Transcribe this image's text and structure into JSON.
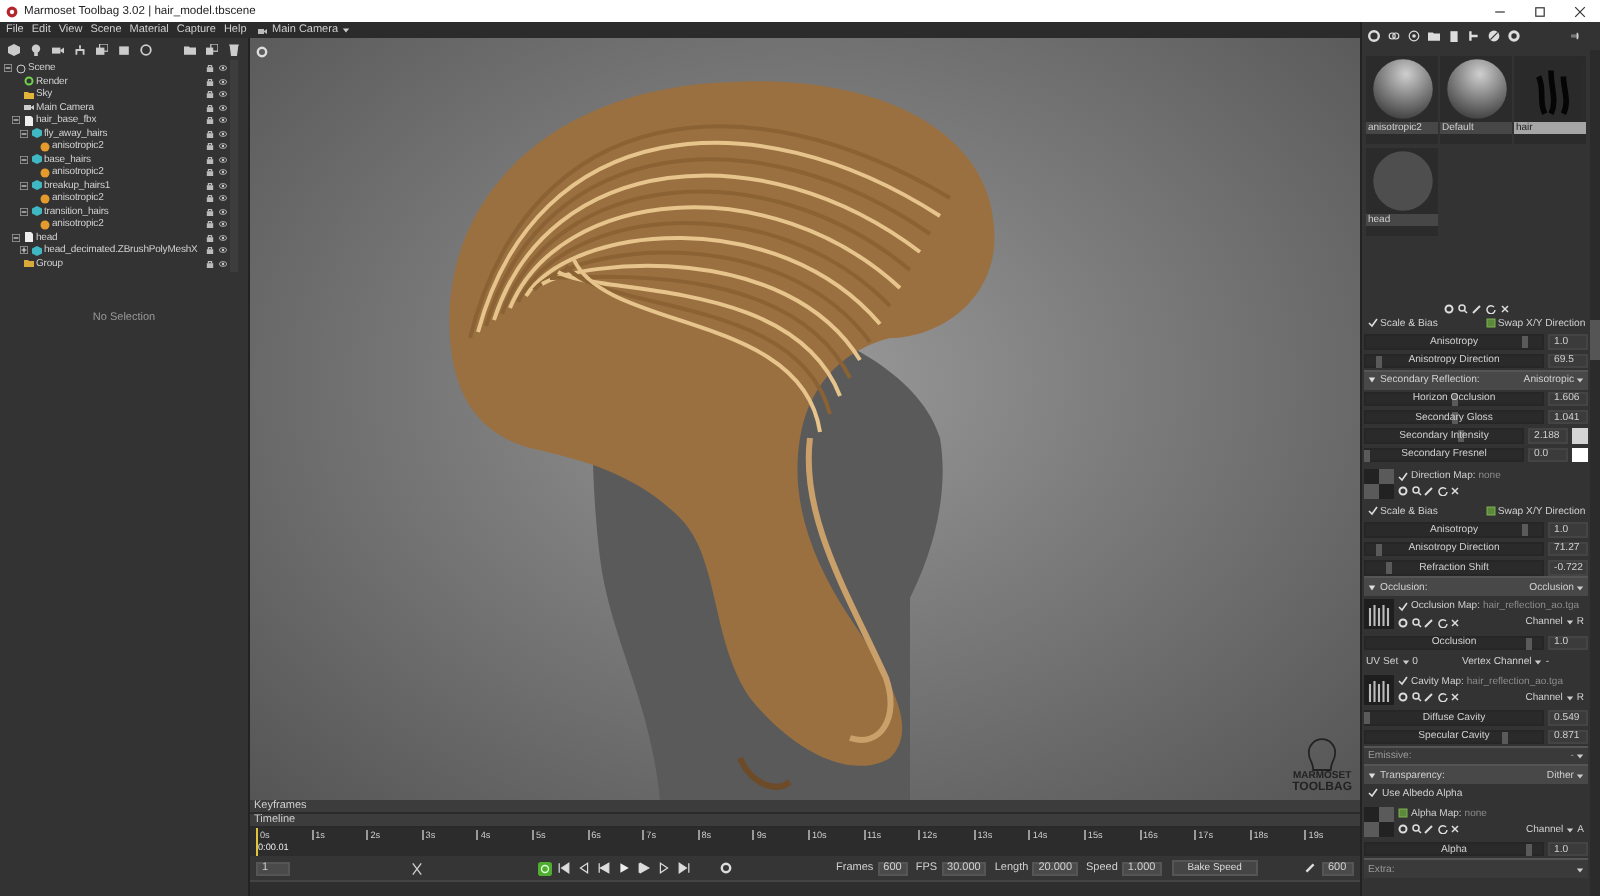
{
  "window": {
    "title": "Marmoset Toolbag 3.02 | hair_model.tbscene"
  },
  "menu": [
    "File",
    "Edit",
    "View",
    "Scene",
    "Material",
    "Capture",
    "Help"
  ],
  "camera_menu": {
    "label": "Main Camera"
  },
  "scene_tree": {
    "items": [
      {
        "label": "Scene",
        "kind": "scene",
        "expanded": true,
        "children": [
          {
            "label": "Render",
            "kind": "render"
          },
          {
            "label": "Sky",
            "kind": "sky"
          },
          {
            "label": "Main Camera",
            "kind": "camera"
          },
          {
            "label": "hair_base_fbx",
            "kind": "file",
            "expanded": true,
            "children": [
              {
                "label": "fly_away_hairs",
                "kind": "mesh",
                "expanded": true,
                "children": [
                  {
                    "label": "anisotropic2",
                    "kind": "material"
                  }
                ]
              },
              {
                "label": "base_hairs",
                "kind": "mesh",
                "expanded": true,
                "children": [
                  {
                    "label": "anisotropic2",
                    "kind": "material"
                  }
                ]
              },
              {
                "label": "breakup_hairs1",
                "kind": "mesh",
                "expanded": true,
                "children": [
                  {
                    "label": "anisotropic2",
                    "kind": "material"
                  }
                ]
              },
              {
                "label": "transition_hairs",
                "kind": "mesh",
                "expanded": true,
                "children": [
                  {
                    "label": "anisotropic2",
                    "kind": "material"
                  }
                ]
              }
            ]
          },
          {
            "label": "head",
            "kind": "file",
            "expanded": true,
            "children": [
              {
                "label": "head_decimated.ZBrushPolyMeshX",
                "kind": "mesh",
                "expanded": false
              }
            ]
          },
          {
            "label": "Group",
            "kind": "folder"
          }
        ]
      }
    ],
    "status": "No Selection"
  },
  "viewport": {
    "logo": [
      "MARMOSET",
      "TOOLBAG"
    ]
  },
  "materials": [
    {
      "name": "anisotropic2",
      "kind": "glossy",
      "selected": false
    },
    {
      "name": "Default",
      "kind": "glossy",
      "selected": false
    },
    {
      "name": "hair",
      "kind": "texture",
      "selected": true
    },
    {
      "name": "head",
      "kind": "matte",
      "selected": false
    }
  ],
  "properties": [
    {
      "kind": "map_tools"
    },
    {
      "kind": "toggles",
      "items": [
        {
          "label": "Scale & Bias",
          "checked": true
        },
        {
          "label": "Swap X/Y Direction",
          "checked": false
        }
      ]
    },
    {
      "kind": "slider",
      "label": "Anisotropy",
      "value": "1.0",
      "level": 0.9
    },
    {
      "kind": "slider",
      "label": "Anisotropy Direction",
      "value": "69.5",
      "level": 0.07
    },
    {
      "kind": "section",
      "title": "Secondary Reflection:",
      "mode": "Anisotropic",
      "expanded": true
    },
    {
      "kind": "slider",
      "label": "Horizon Occlusion",
      "value": "1.606",
      "level": 0.5
    },
    {
      "kind": "slider",
      "label": "Secondary Gloss",
      "value": "1.041",
      "level": 0.5
    },
    {
      "kind": "slider",
      "label": "Secondary Intensity",
      "value": "2.188",
      "level": 0.6,
      "color": "#d4d4d4"
    },
    {
      "kind": "slider",
      "label": "Secondary Fresnel",
      "value": "0.0",
      "level": 0.0,
      "color": "#ffffff"
    },
    {
      "kind": "map",
      "label": "Direction Map:",
      "file": "none",
      "checked": true,
      "has_texture": false
    },
    {
      "kind": "toggles",
      "items": [
        {
          "label": "Scale & Bias",
          "checked": true
        },
        {
          "label": "Swap X/Y Direction",
          "checked": false
        }
      ]
    },
    {
      "kind": "slider",
      "label": "Anisotropy",
      "value": "1.0",
      "level": 0.9
    },
    {
      "kind": "slider",
      "label": "Anisotropy Direction",
      "value": "71.27",
      "level": 0.07
    },
    {
      "kind": "slider",
      "label": "Refraction Shift",
      "value": "-0.722",
      "level": 0.12
    },
    {
      "kind": "section",
      "title": "Occlusion:",
      "mode": "Occlusion",
      "expanded": true
    },
    {
      "kind": "map",
      "label": "Occlusion Map:",
      "file": "hair_reflection_ao.tga",
      "checked": true,
      "has_texture": true,
      "channel_label": "Channel",
      "channel": "R"
    },
    {
      "kind": "slider",
      "label": "Occlusion",
      "value": "1.0",
      "level": 0.92
    },
    {
      "kind": "dropdowns",
      "items": [
        {
          "label": "UV Set",
          "value": "0"
        },
        {
          "label": "Vertex Channel",
          "value": "-"
        }
      ]
    },
    {
      "kind": "map",
      "label": "Cavity Map:",
      "file": "hair_reflection_ao.tga",
      "checked": true,
      "has_texture": true,
      "channel_label": "Channel",
      "channel": "R"
    },
    {
      "kind": "slider",
      "label": "Diffuse Cavity",
      "value": "0.549",
      "level": 0.0
    },
    {
      "kind": "slider",
      "label": "Specular Cavity",
      "value": "0.871",
      "level": 0.78
    },
    {
      "kind": "section",
      "title": "Emissive:",
      "mode": "-",
      "expanded": false
    },
    {
      "kind": "section",
      "title": "Transparency:",
      "mode": "Dither",
      "expanded": true
    },
    {
      "kind": "check",
      "label": "Use Albedo Alpha",
      "checked": true
    },
    {
      "kind": "map",
      "label": "Alpha Map:",
      "file": "none",
      "checked": false,
      "has_texture": false,
      "channel_label": "Channel",
      "channel": "A"
    },
    {
      "kind": "slider",
      "label": "Alpha",
      "value": "1.0",
      "level": 0.92
    },
    {
      "kind": "section",
      "title": "Extra:",
      "expanded": false
    }
  ],
  "timeline": {
    "panels": [
      "Keyframes",
      "Timeline"
    ],
    "ticks": [
      "0s",
      "1s",
      "2s",
      "3s",
      "4s",
      "5s",
      "6s",
      "7s",
      "8s",
      "9s",
      "10s",
      "11s",
      "12s",
      "13s",
      "14s",
      "15s",
      "16s",
      "17s",
      "18s",
      "19s"
    ],
    "time": "0:00.01",
    "frame": "1",
    "loop": true,
    "fields": [
      {
        "label": "Frames",
        "value": "600"
      },
      {
        "label": "FPS",
        "value": "30.000"
      },
      {
        "label": "Length",
        "value": "20.000"
      },
      {
        "label": "Speed",
        "value": "1.000"
      }
    ],
    "bake_button": "Bake Speed",
    "end_frame": "600"
  }
}
